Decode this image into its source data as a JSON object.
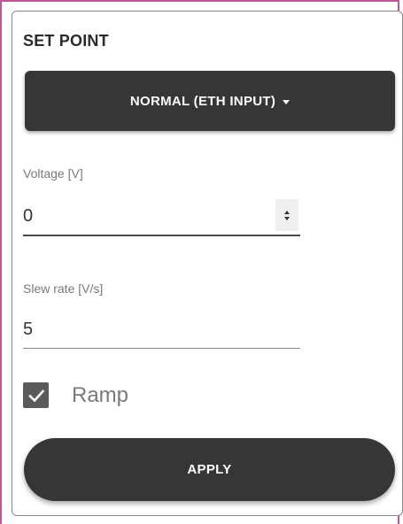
{
  "panel": {
    "title": "SET POINT"
  },
  "mode_select": {
    "label": "NORMAL (ETH INPUT)",
    "icon": "caret-down-icon"
  },
  "voltage": {
    "label": "Voltage [V]",
    "value": "0"
  },
  "slew_rate": {
    "label": "Slew rate [V/s]",
    "value": "5"
  },
  "ramp": {
    "label": "Ramp",
    "checked": true
  },
  "actions": {
    "apply_label": "APPLY"
  },
  "colors": {
    "button_bg": "#363636",
    "checkbox_bg": "#5a5a5a",
    "accent_border": "#c0559a"
  }
}
